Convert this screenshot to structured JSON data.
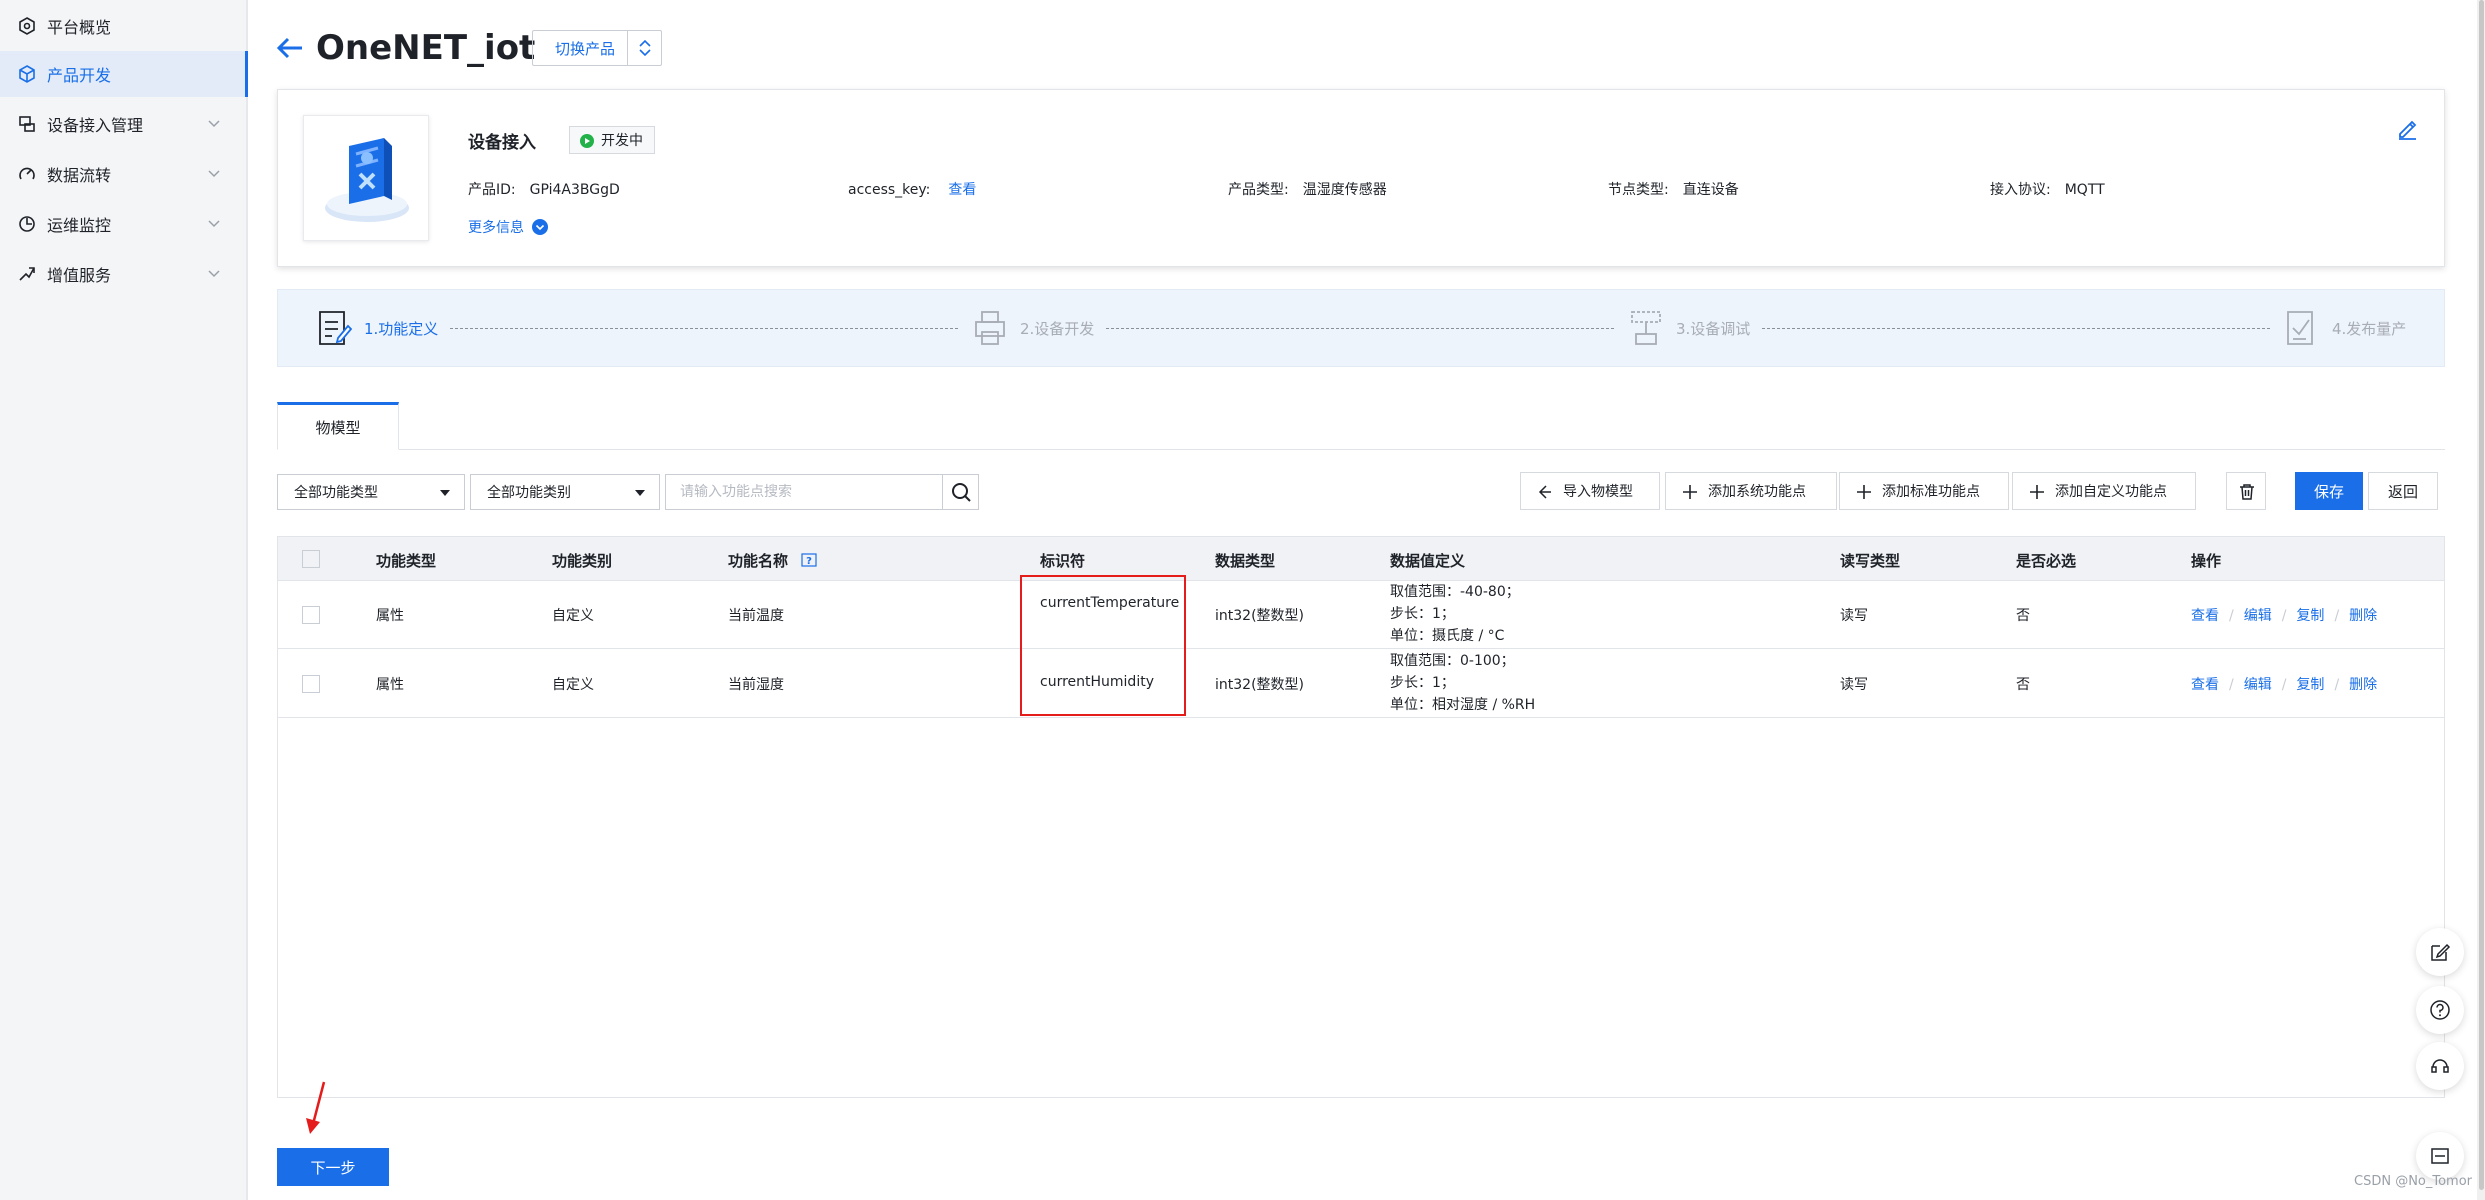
{
  "sidebar": {
    "items": [
      {
        "label": "平台概览",
        "icon": "overview-icon"
      },
      {
        "label": "产品开发",
        "icon": "cube-icon",
        "active": true
      },
      {
        "label": "设备接入管理",
        "icon": "device-icon"
      },
      {
        "label": "数据流转",
        "icon": "flow-icon"
      },
      {
        "label": "运维监控",
        "icon": "monitor-icon"
      },
      {
        "label": "增值服务",
        "icon": "service-icon"
      }
    ]
  },
  "header": {
    "title": "OneNET_iot",
    "switch_label": "切换产品"
  },
  "product": {
    "name": "设备接入",
    "status": "开发中",
    "id_label": "产品ID:",
    "id_value": "GPi4A3BGgD",
    "access_key_label": "access_key:",
    "access_key_link": "查看",
    "type_label": "产品类型:",
    "type_value": "温湿度传感器",
    "node_label": "节点类型:",
    "node_value": "直连设备",
    "protocol_label": "接入协议:",
    "protocol_value": "MQTT",
    "more_label": "更多信息"
  },
  "steps": [
    {
      "label": "1.功能定义",
      "active": true
    },
    {
      "label": "2.设备开发",
      "active": false
    },
    {
      "label": "3.设备调试",
      "active": false
    },
    {
      "label": "4.发布量产",
      "active": false
    }
  ],
  "tabs": [
    {
      "label": "物模型"
    }
  ],
  "toolbar": {
    "filter_type": "全部功能类型",
    "filter_category": "全部功能类别",
    "search_placeholder": "请输入功能点搜索",
    "import_label": "导入物模型",
    "add_system_label": "添加系统功能点",
    "add_standard_label": "添加标准功能点",
    "add_custom_label": "添加自定义功能点",
    "save_label": "保存",
    "return_label": "返回"
  },
  "table": {
    "headers": [
      "功能类型",
      "功能类别",
      "功能名称",
      "标识符",
      "数据类型",
      "数据值定义",
      "读写类型",
      "是否必选",
      "操作"
    ],
    "rows": [
      {
        "type": "属性",
        "category": "自定义",
        "name": "当前温度",
        "identifier": "currentTemperature",
        "data_type": "int32(整数型)",
        "def_range": "取值范围：-40-80；",
        "def_step": "步长：1；",
        "def_unit": "单位：摄氏度 / °C",
        "rw": "读写",
        "required": "否"
      },
      {
        "type": "属性",
        "category": "自定义",
        "name": "当前湿度",
        "identifier": "currentHumidity",
        "data_type": "int32(整数型)",
        "def_range": "取值范围：0-100；",
        "def_step": "步长：1；",
        "def_unit": "单位：相对湿度 / %RH",
        "rw": "读写",
        "required": "否"
      }
    ],
    "ops": {
      "view": "查看",
      "edit": "编辑",
      "copy": "复制",
      "delete": "删除"
    }
  },
  "footer": {
    "next_label": "下一步",
    "watermark": "CSDN @No_Tomor"
  },
  "colors": {
    "accent": "#1a6fe8",
    "status_green": "#23b24a",
    "annotation_red": "#e51c1c"
  }
}
